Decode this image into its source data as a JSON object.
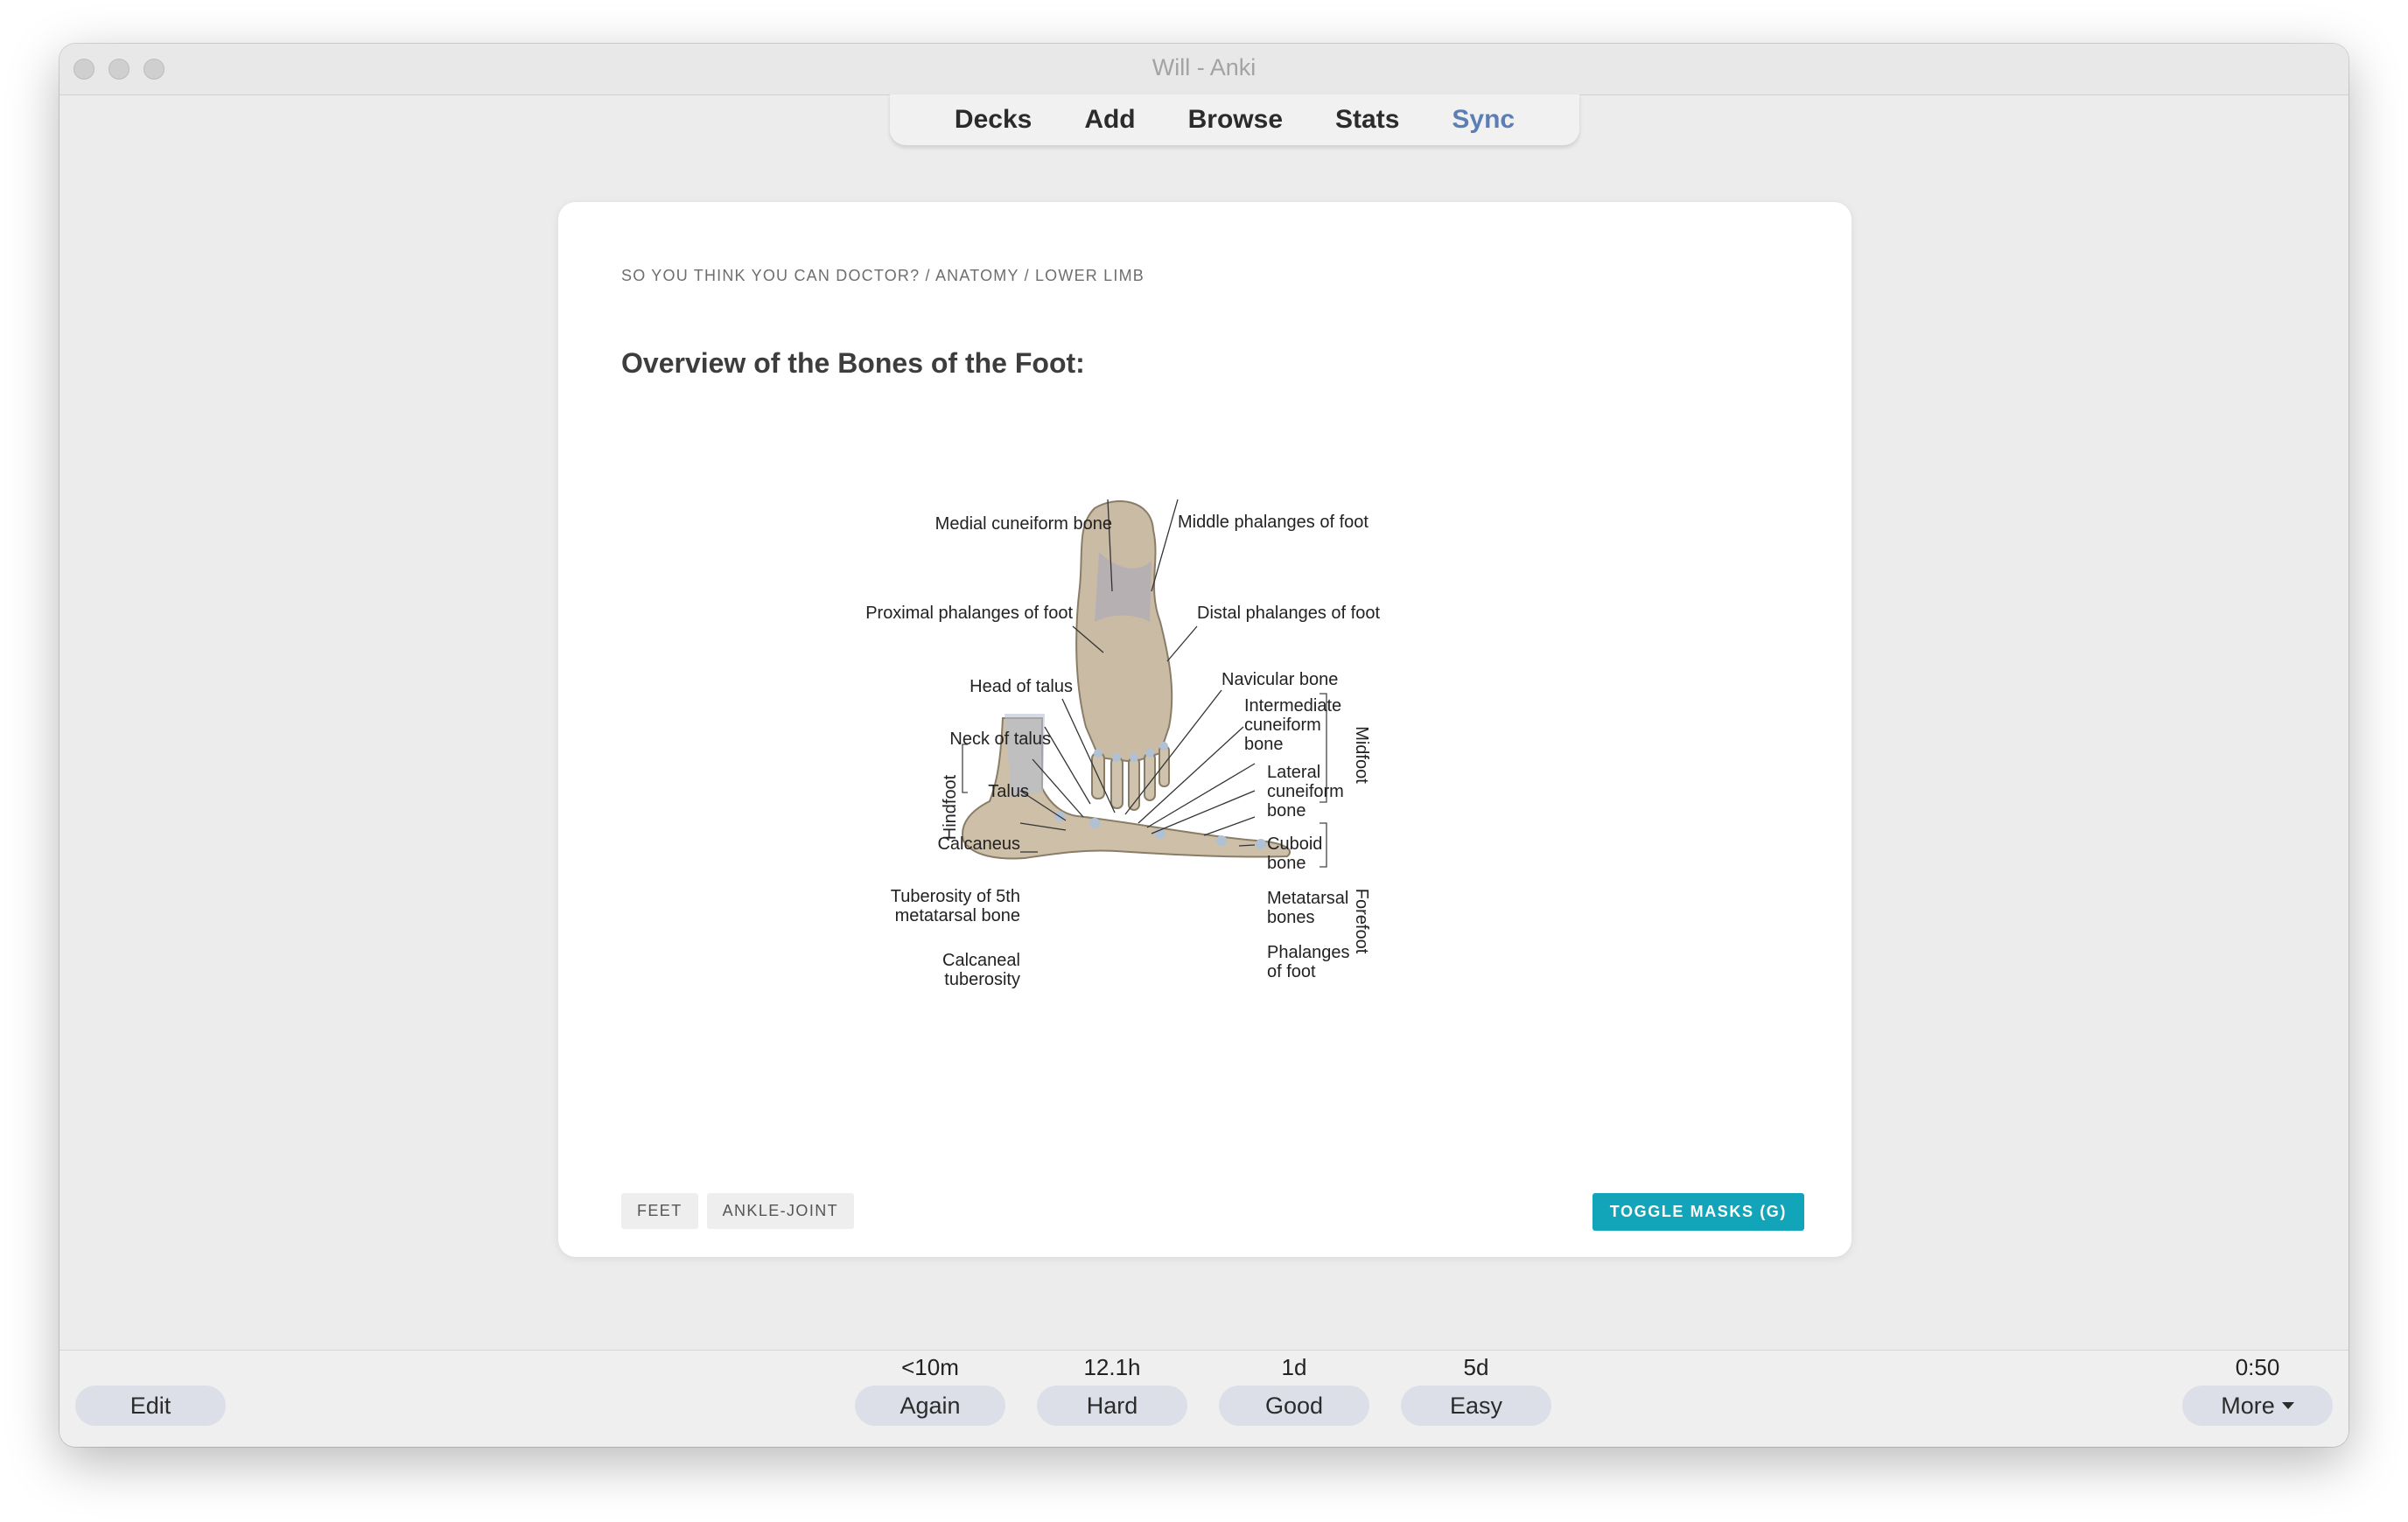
{
  "window": {
    "title": "Will - Anki"
  },
  "toolbar": {
    "decks": "Decks",
    "add": "Add",
    "browse": "Browse",
    "stats": "Stats",
    "sync": "Sync"
  },
  "card": {
    "breadcrumb": "SO YOU THINK YOU CAN DOCTOR? / ANATOMY / LOWER LIMB",
    "heading": "Overview of the Bones of the Foot:",
    "figure": {
      "labels": {
        "medial_cuneiform": "Medial cuneiform bone",
        "middle_phalanges": "Middle phalanges of foot",
        "proximal_phalanges": "Proximal phalanges of foot",
        "distal_phalanges": "Distal phalanges of foot",
        "head_talus": "Head of talus",
        "neck_talus": "Neck of talus",
        "talus": "Talus",
        "calcaneus": "Calcaneus",
        "tuberosity_5th": [
          "Tuberosity of 5th",
          "metatarsal bone"
        ],
        "calcaneal_tuberosity": [
          "Calcaneal",
          "tuberosity"
        ],
        "navicular": "Navicular bone",
        "intermediate_cuneiform": [
          "Intermediate",
          "cuneiform",
          "bone"
        ],
        "lateral_cuneiform": [
          "Lateral",
          "cuneiform",
          "bone"
        ],
        "cuboid": [
          "Cuboid",
          "bone"
        ],
        "metatarsal": [
          "Metatarsal",
          "bones"
        ],
        "phalanges": [
          "Phalanges",
          "of foot"
        ],
        "hindfoot": "Hindfoot",
        "midfoot": "Midfoot",
        "forefoot": "Forefoot"
      }
    },
    "tags": [
      "FEET",
      "ANKLE-JOINT"
    ],
    "toggle_masks": "TOGGLE MASKS (G)"
  },
  "bottom": {
    "edit": "Edit",
    "answers": [
      {
        "label": "Again",
        "time": "<10m"
      },
      {
        "label": "Hard",
        "time": "12.1h"
      },
      {
        "label": "Good",
        "time": "1d"
      },
      {
        "label": "Easy",
        "time": "5d"
      }
    ],
    "timer": "0:50",
    "more": "More"
  },
  "colors": {
    "accent_toggle": "#12a4b8",
    "sync_link": "#5b7fb5",
    "answer_button": "#dcdfe7"
  }
}
